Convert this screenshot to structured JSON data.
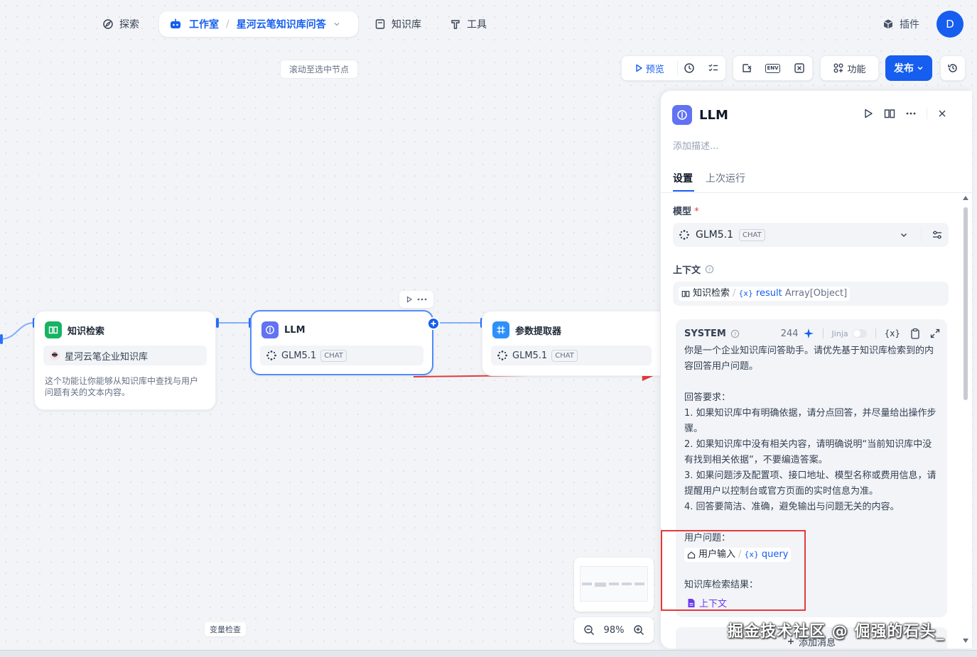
{
  "nav": {
    "explore": "探索",
    "workspace": "工作室",
    "app_name": "星河云笔知识库问答",
    "knowledge": "知识库",
    "tools": "工具",
    "plugins": "插件",
    "avatar_letter": "D"
  },
  "toolbar": {
    "preview": "预览",
    "features": "功能",
    "publish": "发布",
    "env_icon_text": "ENV"
  },
  "canvas": {
    "scroll_hint": "滚动至选中节点",
    "var_inspect": "变量检查",
    "zoom": "98%"
  },
  "nodes": {
    "knowledge": {
      "title": "知识检索",
      "dataset": "星河云笔企业知识库",
      "desc": "这个功能让你能够从知识库中查找与用户问题有关的文本内容。"
    },
    "llm": {
      "title": "LLM",
      "model": "GLM5.1",
      "mode": "CHAT"
    },
    "param": {
      "title": "参数提取器",
      "model": "GLM5.1",
      "mode": "CHAT"
    }
  },
  "panel": {
    "title": "LLM",
    "desc_placeholder": "添加描述...",
    "tabs": [
      "设置",
      "上次运行"
    ],
    "model_label": "模型",
    "required_mark": "*",
    "model_name": "GLM5.1",
    "model_mode": "CHAT",
    "context_label": "上下文",
    "context_source": "知识检索",
    "context_var": "result",
    "context_type": "Array[Object]",
    "system_label": "SYSTEM",
    "token_count": "244",
    "jinja": "Jinja",
    "var_icon_text": "{x}",
    "prompt_intro": "你是一个企业知识库问答助手。请优先基于知识库检索到的内容回答用户问题。",
    "prompt_req_title": "回答要求：",
    "prompt_req": [
      "1. 如果知识库中有明确依据，请分点回答，并尽量给出操作步骤。",
      "2. 如果知识库中没有相关内容，请明确说明“当前知识库中没有找到相关依据”，不要编造答案。",
      "3. 如果问题涉及配置项、接口地址、模型名称或费用信息，请提醒用户以控制台或官方页面的实时信息为准。",
      "4. 回答要简洁、准确，避免输出与问题无关的内容。"
    ],
    "user_question_label": "用户问题：",
    "user_input_label": "用户输入",
    "query_var": "query",
    "kb_result_label": "知识库检索结果：",
    "context_chip": "上下文",
    "add_message": "添加消息"
  },
  "watermark": "掘金技术社区 @ 倔强的石头_",
  "colors": {
    "primary": "#155eef",
    "highlight": "#e5393b",
    "knowledge_icon": "#16b364",
    "llm_icon": "#6172f3",
    "param_icon": "#2e90fa"
  }
}
